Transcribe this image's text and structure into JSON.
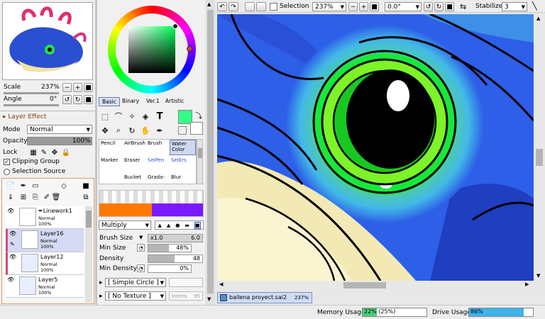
{
  "navigator": {
    "scale_label": "Scale",
    "scale_value": "237%",
    "angle_label": "Angle",
    "angle_value": "0°"
  },
  "layer_panel": {
    "effect_header": "Layer Effect",
    "mode_label": "Mode",
    "mode_value": "Normal",
    "opacity_label": "Opacity",
    "opacity_value": "100%",
    "lock_label": "Lock",
    "clipping_label": "Clipping Group",
    "selection_source_label": "Selection Source",
    "layers": [
      {
        "name": "Linework1",
        "mode": "Normal",
        "opacity": "100%"
      },
      {
        "name": "Layer16",
        "mode": "Normal",
        "opacity": "100%"
      },
      {
        "name": "Layer12",
        "mode": "Normal",
        "opacity": "100%"
      },
      {
        "name": "Layer5",
        "mode": "Normal",
        "opacity": "100%"
      }
    ]
  },
  "color_panel": {
    "tabs": [
      "Basic",
      "Binary",
      "Ver.1",
      "Artistic"
    ],
    "primary_color": "#33ff88"
  },
  "tool_panel": {
    "brushes": [
      {
        "label": "Pencil"
      },
      {
        "label": "AirBrush"
      },
      {
        "label": "Brush"
      },
      {
        "label": "Water Color"
      },
      {
        "label": "Marker"
      },
      {
        "label": "Eraser"
      },
      {
        "label": "SelPen"
      },
      {
        "label": "SelErs"
      },
      {
        "label": ""
      },
      {
        "label": "Bucket"
      },
      {
        "label": "Grada-"
      },
      {
        "label": "Blur"
      }
    ],
    "blend_mode": "Multiply",
    "brush_size_label": "Brush Size",
    "brush_size_mult": "x1.0",
    "brush_size_value": "6.0",
    "min_size_label": "Min Size",
    "min_size_value": "48%",
    "density_label": "Density",
    "density_value": "48",
    "min_density_label": "Min Density",
    "min_density_value": "0%",
    "shape_label": "[ Simple Circle ]",
    "texture_label": "[ No Texture ]",
    "texture_intensity": "Intens",
    "texture_value": "95"
  },
  "toolbar": {
    "selection_label": "Selection",
    "zoom_value": "237%",
    "angle_value": "0.0°",
    "stabilizer_label": "Stabilizer",
    "stabilizer_value": "3"
  },
  "document": {
    "filename": "ballena proyect.sai2",
    "zoom": "237%"
  },
  "status": {
    "memory_label": "Memory Usage",
    "memory_value": "22% (25%)",
    "memory_fill": 0.22,
    "drive_label": "Drive Usage",
    "drive_value": "86%",
    "drive_fill": 0.86
  }
}
